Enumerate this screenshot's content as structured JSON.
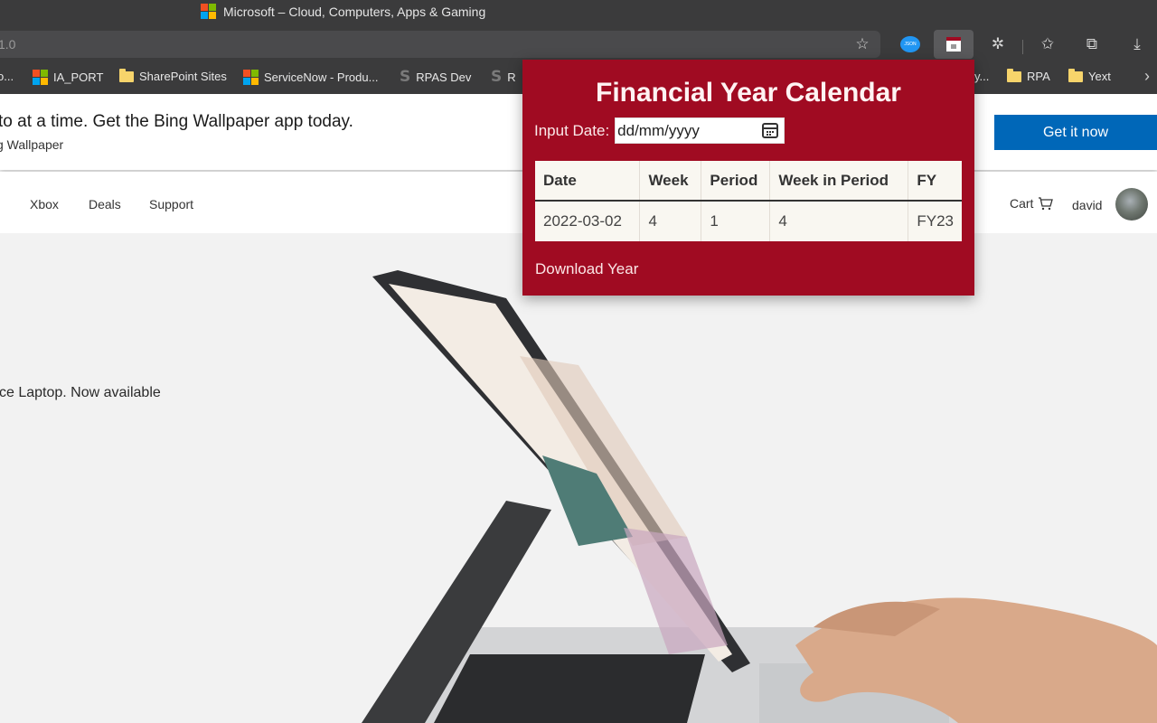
{
  "browser": {
    "window_title": "Microsoft – Cloud, Computers, Apps & Gaming",
    "address_text": "1.0",
    "toolbar_icons": [
      {
        "name": "add-favorite-icon",
        "glyph": "☆"
      },
      {
        "name": "json-extension-icon",
        "glyph": "JSON"
      },
      {
        "name": "calendar-extension-icon",
        "glyph": ""
      },
      {
        "name": "extensions-icon",
        "glyph": "✲"
      },
      {
        "name": "favorites-icon",
        "glyph": "☆"
      },
      {
        "name": "collections-icon",
        "glyph": "⧉"
      },
      {
        "name": "downloads-icon",
        "glyph": "⤓"
      }
    ],
    "bookmarks": [
      {
        "label": "o...",
        "icon": "none"
      },
      {
        "label": "IA_PORT",
        "icon": "ms-logo"
      },
      {
        "label": "SharePoint Sites",
        "icon": "folder"
      },
      {
        "label": "ServiceNow - Produ...",
        "icon": "ms-logo"
      },
      {
        "label": "RPAS Dev",
        "icon": "s-logo"
      },
      {
        "label": "R",
        "icon": "s-logo"
      },
      {
        "label": "y...",
        "icon": "none"
      },
      {
        "label": "RPA",
        "icon": "folder"
      },
      {
        "label": "Yext",
        "icon": "folder"
      }
    ],
    "bookmarks_more": "›"
  },
  "page": {
    "banner": {
      "headline": "to at a time. Get the Bing Wallpaper app today.",
      "subtext": "g Wallpaper",
      "cta_label": "Get it now",
      "cta_color": "#0067b8"
    },
    "nav": {
      "items": [
        "Xbox",
        "Deals",
        "Support"
      ],
      "cart_label": "Cart",
      "user_name": "david"
    },
    "hero": {
      "text": "ce Laptop. Now available"
    }
  },
  "popup": {
    "title": "Financial Year Calendar",
    "input_label": "Input Date:",
    "input_placeholder": "dd/mm/yyyy",
    "table": {
      "headers": [
        "Date",
        "Week",
        "Period",
        "Week in Period",
        "FY"
      ],
      "rows": [
        [
          "2022-03-02",
          "4",
          "1",
          "4",
          "FY23"
        ]
      ]
    },
    "download_label": "Download Year",
    "accent_color": "#a00b22"
  }
}
